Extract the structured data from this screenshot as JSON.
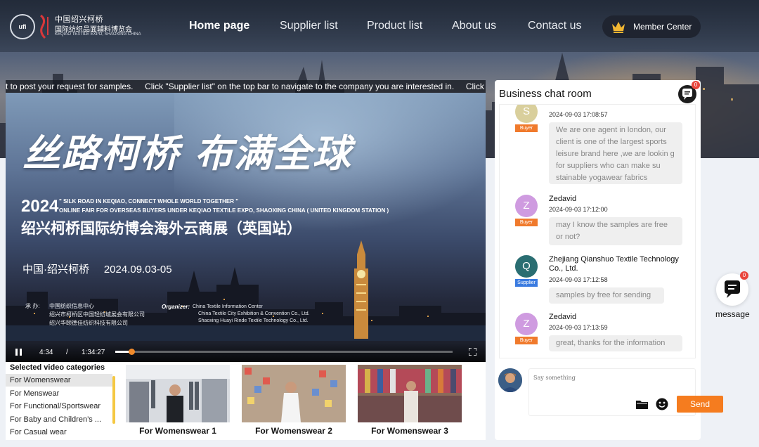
{
  "header": {
    "logo": {
      "ufi_text": "ufi",
      "cn_line1": "中国绍兴柯桥",
      "cn_line2": "国际纺织品面辅料博览会",
      "en_line": "KEQIAO TEXTILE EXPO, SHAOXING CHINA"
    },
    "nav": [
      {
        "label": "Home page",
        "active": true
      },
      {
        "label": "Supplier list",
        "active": false
      },
      {
        "label": "Product list",
        "active": false
      },
      {
        "label": "About us",
        "active": false
      },
      {
        "label": "Contact us",
        "active": false
      }
    ],
    "member_center": "Member Center"
  },
  "ticker": {
    "text": "t to post your request for samples.     Click \"Supplier list\" on the top bar to navigate to the company you are interested in.     Click"
  },
  "video": {
    "title_calligraphy": "丝路柯桥  布满全球",
    "year": "2024",
    "en_line1": "\" SILK ROAD IN KEQIAO, CONNECT WHOLE WORLD TOGETHER \"",
    "en_line2": "ONLINE FAIR FOR OVERSEAS BUYERS UNDER KEQIAO TEXTILE EXPO, SHAOXING CHINA ( UNITED KINGDOM STATION )",
    "subtitle": "绍兴柯桥国际纺博会海外云商展（英国站）",
    "location_date": "中国·绍兴柯桥     2024.09.03-05",
    "host_label": "承 办:",
    "host_lines": [
      "中国纺织信息中心",
      "绍兴市柯桥区中国轻纺城展会有限公司",
      "绍兴华颐德佳纺织科技有限公司"
    ],
    "organizer_label": "Organizer:",
    "organizer_lines": [
      "China Textile Information Center",
      "China Textile City Exhibition & Convention Co., Ltd.",
      "Shaoxing Huayi Rinde Textile Technology Co., Ltd."
    ],
    "current_time": "4:34",
    "separator": "/",
    "duration": "1:34:27",
    "progress": 0.048
  },
  "categories": {
    "title": "Selected video categories",
    "items": [
      {
        "label": "For Womenswear",
        "selected": true
      },
      {
        "label": "For Menswear",
        "selected": false
      },
      {
        "label": "For Functional/Sportswear",
        "selected": false
      },
      {
        "label": "For Baby and Children’s ...",
        "selected": false
      },
      {
        "label": "For Casual wear",
        "selected": false
      }
    ],
    "videos": [
      {
        "label": "For Womenswear 1"
      },
      {
        "label": "For Womenswear 2"
      },
      {
        "label": "For Womenswear 3"
      }
    ]
  },
  "chat": {
    "title": "Business chat room",
    "unread": "0",
    "messages": [
      {
        "avatar": "S",
        "avatar_color": "#d9cf9c",
        "role": "Buyer",
        "sender": "",
        "time": "2024-09-03 17:08:57",
        "text": "We are one agent in london, our client is one of the largest sports leisure brand here ,we are lookin g for suppliers who can make su stainable yogawear fabrics"
      },
      {
        "avatar": "Z",
        "avatar_color": "#cf9be0",
        "role": "Buyer",
        "sender": "Zedavid",
        "time": "2024-09-03 17:12:00",
        "text": "may I know the samples are free or not?"
      },
      {
        "avatar": "Q",
        "avatar_color": "#2a6e72",
        "role": "Supplier",
        "sender": "Zhejiang Qianshuo Textile Technology Co., Ltd.",
        "time": "2024-09-03 17:12:58",
        "text": "samples by free for sending"
      },
      {
        "avatar": "Z",
        "avatar_color": "#cf9be0",
        "role": "Buyer",
        "sender": "Zedavid",
        "time": "2024-09-03 17:13:59",
        "text": "great, thanks for the information"
      }
    ],
    "input_placeholder": "Say something",
    "send_label": "Send"
  },
  "float_message": {
    "label": "message",
    "unread": "0"
  },
  "colors": {
    "accent": "#f57c1f",
    "buyer": "#f07a2c",
    "supplier": "#3a7be0"
  }
}
